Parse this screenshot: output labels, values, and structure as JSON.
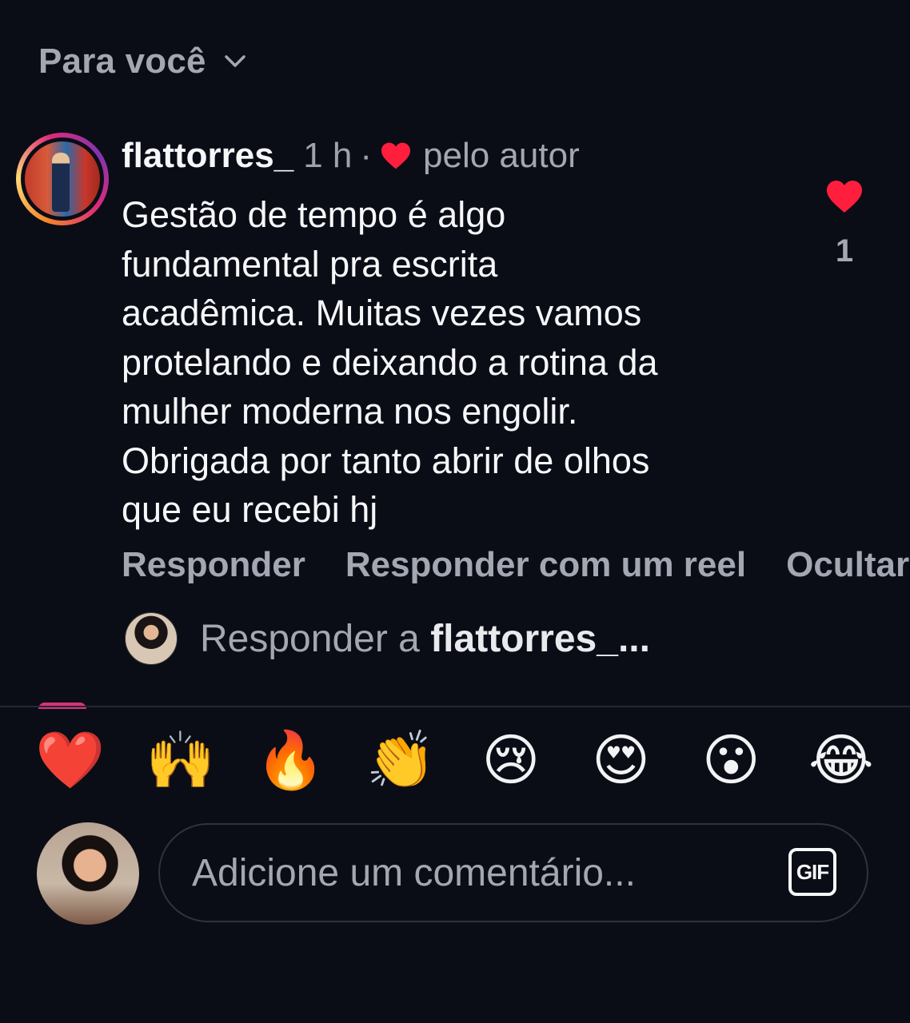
{
  "header": {
    "title": "Para você"
  },
  "comment": {
    "username": "flattorres_",
    "time": "1 h",
    "separator": "·",
    "liked_by_author": "pelo autor",
    "text": "Gestão de tempo é algo\nfundamental pra escrita\nacadêmica.  Muitas vezes vamos\nprotelando e  deixando a rotina da\nmulher moderna nos engolir.\nObrigada por tanto abrir de olhos\nque eu recebi hj",
    "like_count": "1",
    "actions": [
      "Responder",
      "Responder com um reel",
      "Ocultar"
    ]
  },
  "reply_prompt": {
    "prefix": "Responder a ",
    "name": "flattorres_..."
  },
  "emoji_bar": [
    "❤️",
    "🙌",
    "🔥",
    "👏",
    "😢",
    "😍",
    "😮",
    "😂"
  ],
  "composer": {
    "placeholder": "Adicione um comentário...",
    "gif_label": "GIF"
  },
  "colors": {
    "background": "#0b0d16",
    "heart": "#ff1f3d",
    "muted": "#a3a7b1"
  }
}
